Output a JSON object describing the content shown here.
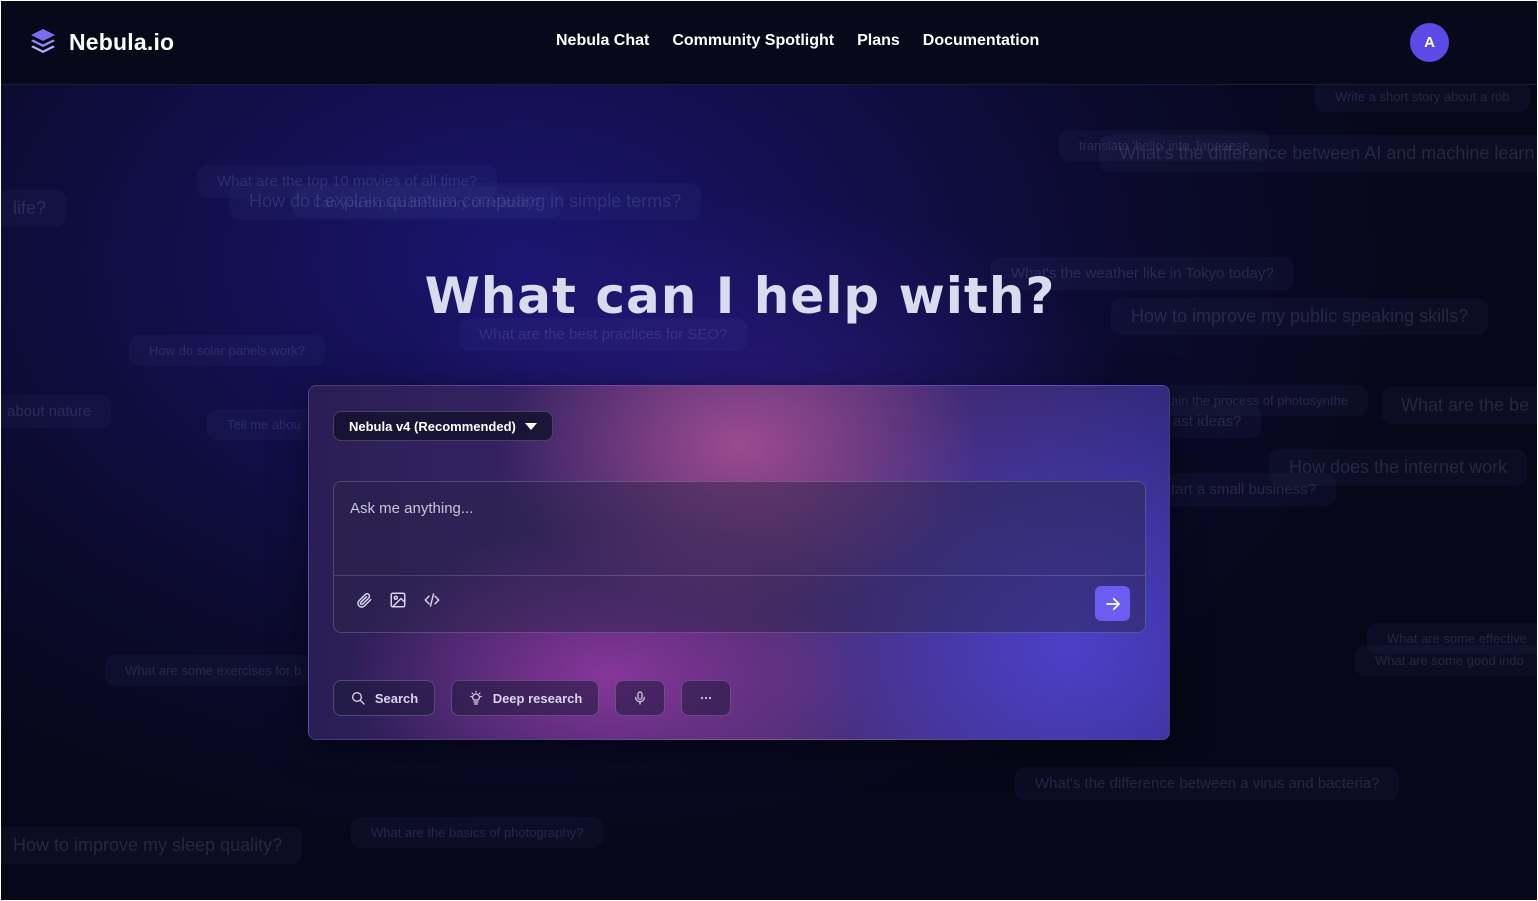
{
  "brand": {
    "name": "Nebula.io",
    "logo_icon": "layers-icon"
  },
  "nav": {
    "items": [
      {
        "label": "Nebula Chat"
      },
      {
        "label": "Community Spotlight"
      },
      {
        "label": "Plans"
      },
      {
        "label": "Documentation"
      }
    ]
  },
  "user": {
    "avatar_initial": "A",
    "avatar_color": "#5b4ae6"
  },
  "hero": {
    "title": "What can I help with?"
  },
  "composer": {
    "model_label": "Nebula v4 (Recommended)",
    "input_placeholder": "Ask me anything...",
    "input_value": "",
    "tools": [
      "paperclip-icon",
      "image-icon",
      "code-icon"
    ],
    "send_icon": "arrow-right-icon",
    "accent_color": "#6b5cf2"
  },
  "actions": {
    "search_label": "Search",
    "deep_research_label": "Deep research",
    "mic_icon": "microphone-icon",
    "more_icon": "ellipsis-icon"
  },
  "background_suggestions": [
    "Write a short story about a rob",
    "translate 'hello' into Japanese",
    "What's the difference between AI and machine learn",
    "What are the top 10 movies of all time?",
    "Can you explain the theory of relativity?",
    "How do I explain quantum computing in simple terms?",
    "life?",
    "What's the weather like in Tokyo today?",
    "How to improve my public speaking skills?",
    "What are the best practices for SEO?",
    "How do solar panels work?",
    "about nature",
    "Tell me abou",
    "ain the process of photosynthe",
    "What are the be",
    "ast ideas?",
    "How does the internet work",
    "tart a small business?",
    "What are some exercises for b",
    "What are some effective",
    "What are some good indo",
    "What's the difference between a virus and bacteria?",
    "How to improve my sleep quality?",
    "What are the basics of photography?"
  ]
}
